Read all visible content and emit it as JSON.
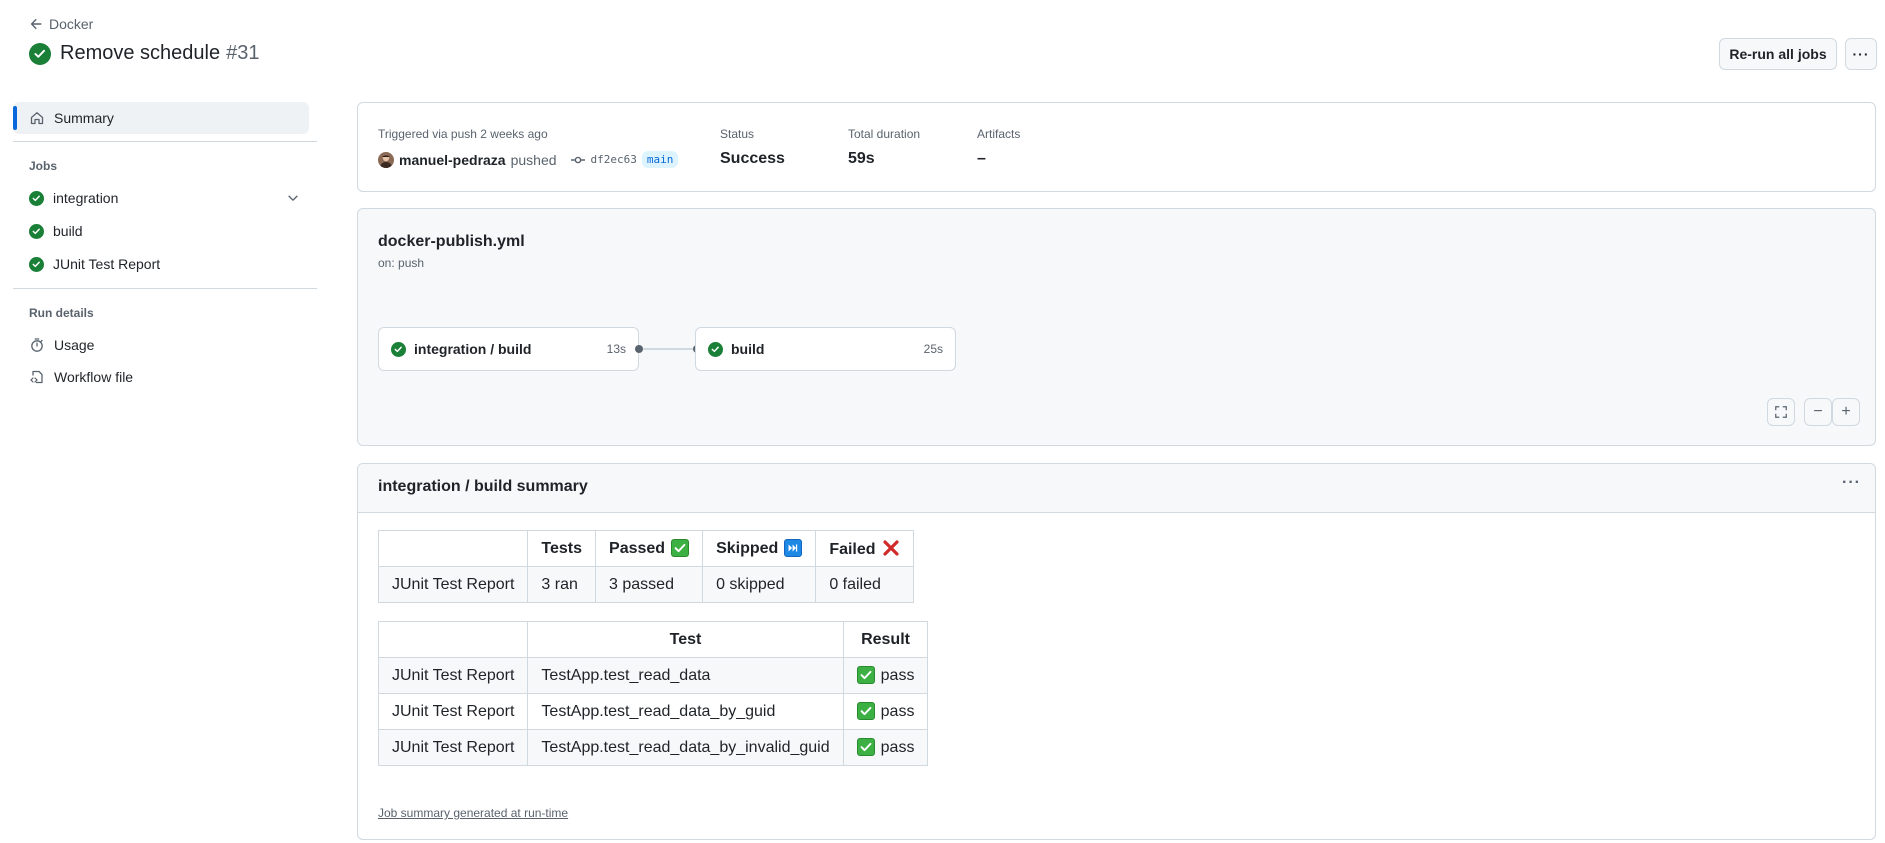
{
  "header": {
    "back_label": "Docker",
    "title": "Remove schedule",
    "run_number": "#31",
    "rerun_label": "Re-run all jobs",
    "more_label": "···"
  },
  "sidebar": {
    "summary_label": "Summary",
    "jobs_heading": "Jobs",
    "jobs": [
      {
        "label": "integration"
      },
      {
        "label": "build"
      },
      {
        "label": "JUnit Test Report"
      }
    ],
    "run_details_heading": "Run details",
    "usage_label": "Usage",
    "workflow_file_label": "Workflow file"
  },
  "run_info": {
    "trigger": "Triggered via push 2 weeks ago",
    "actor": "manuel-pedraza",
    "action": "pushed",
    "commit": "df2ec63",
    "branch": "main",
    "status_label": "Status",
    "status_value": "Success",
    "duration_label": "Total duration",
    "duration_value": "59s",
    "artifacts_label": "Artifacts",
    "artifacts_value": "–"
  },
  "workflow": {
    "file": "docker-publish.yml",
    "trigger": "on: push",
    "jobs": [
      {
        "name": "integration / build",
        "duration": "13s"
      },
      {
        "name": "build",
        "duration": "25s"
      }
    ],
    "controls": {
      "fullscreen": "⛶",
      "zoom_out": "−",
      "zoom_in": "+"
    }
  },
  "job_summary": {
    "title": "integration / build summary",
    "more_label": "···",
    "stats_table": {
      "headers": [
        "",
        "Tests",
        "Passed",
        "Skipped",
        "Failed"
      ],
      "row": [
        "JUnit Test Report",
        "3 ran",
        "3 passed",
        "0 skipped",
        "0 failed"
      ]
    },
    "results_table": {
      "headers": [
        "",
        "Test",
        "Result"
      ],
      "rows": [
        [
          "JUnit Test Report",
          "TestApp.test_read_data",
          "pass"
        ],
        [
          "JUnit Test Report",
          "TestApp.test_read_data_by_guid",
          "pass"
        ],
        [
          "JUnit Test Report",
          "TestApp.test_read_data_by_invalid_guid",
          "pass"
        ]
      ]
    },
    "footer_link": "Job summary generated at run-time"
  },
  "colors": {
    "success": "#1a7f37",
    "accent": "#0969da",
    "border": "#d1d9e0"
  }
}
